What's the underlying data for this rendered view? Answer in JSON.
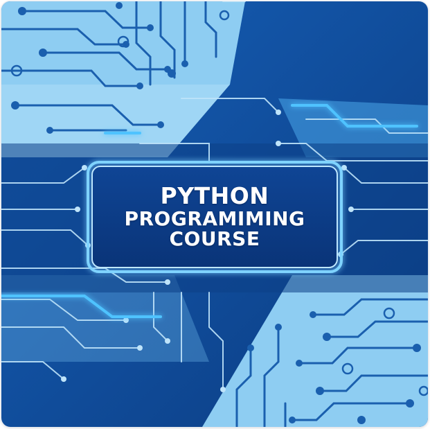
{
  "badge": {
    "title_lines": [
      "PYTHON",
      "PROGRAMIMING",
      "COURSE"
    ]
  },
  "colors": {
    "deep_blue": "#0d3f86",
    "mid_blue": "#1356a8",
    "light_blue": "#8ecdf2",
    "trace_light": "#bfe4fa",
    "glow": "#4fc3ff",
    "text": "#ffffff"
  },
  "icons": [
    "circuit-board-pattern"
  ]
}
